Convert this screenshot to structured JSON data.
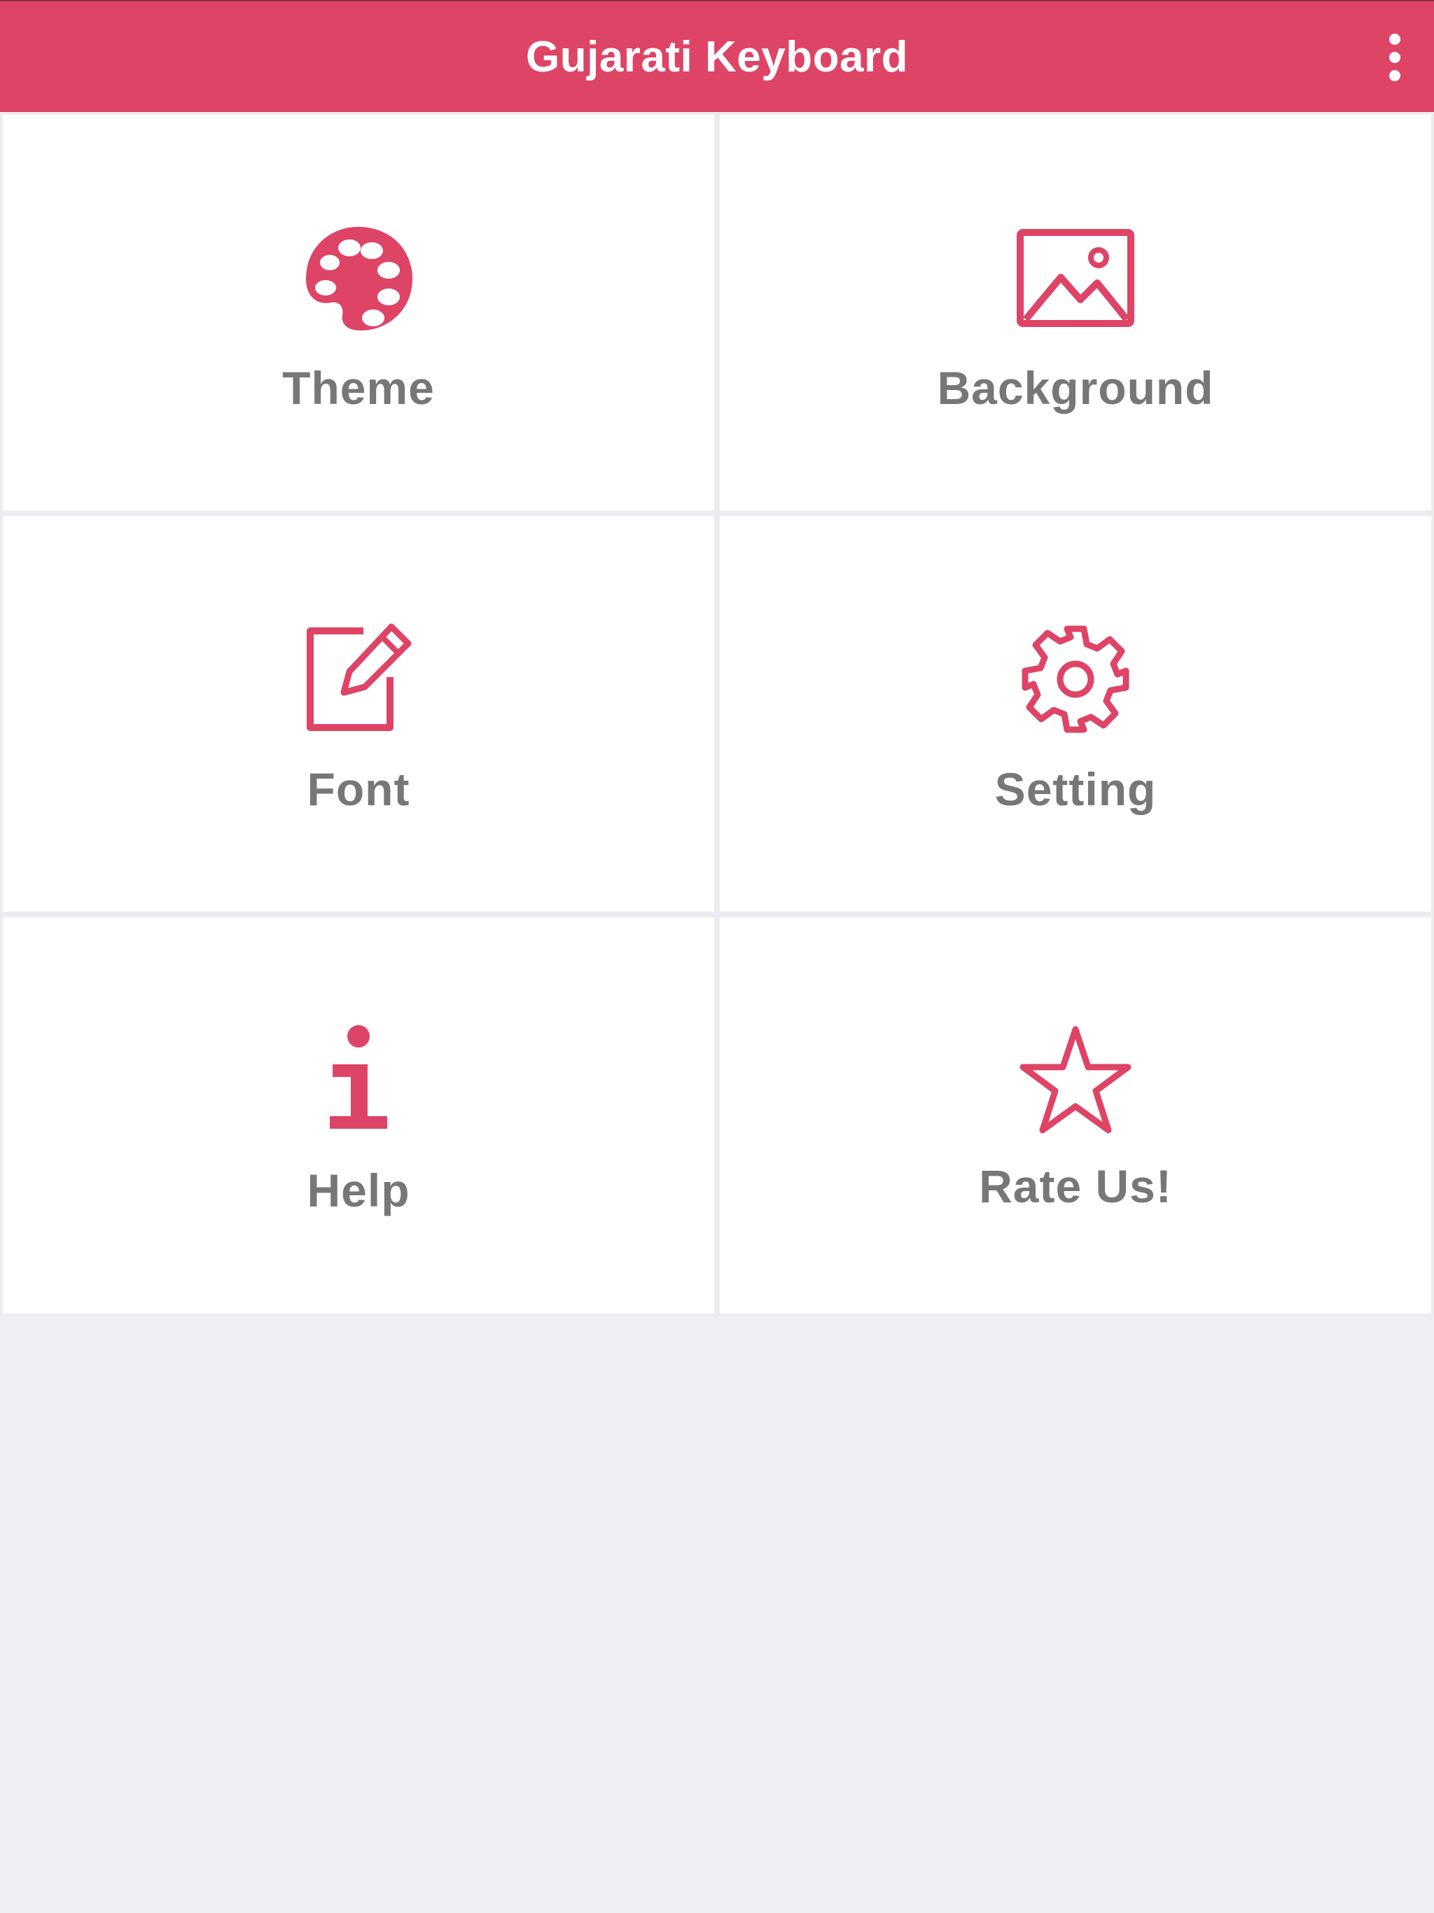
{
  "appbar": {
    "title": "Gujarati Keyboard",
    "background_color": "#de4465",
    "menu_icon": "more-vert-icon"
  },
  "menu": {
    "accent_color": "#de4465",
    "label_color": "#777777",
    "items": [
      {
        "label": "Theme",
        "icon": "palette-icon"
      },
      {
        "label": "Background",
        "icon": "image-icon"
      },
      {
        "label": "Font",
        "icon": "edit-icon"
      },
      {
        "label": "Setting",
        "icon": "gear-icon"
      },
      {
        "label": "Help",
        "icon": "info-icon"
      },
      {
        "label": "Rate Us!",
        "icon": "star-icon"
      }
    ]
  }
}
